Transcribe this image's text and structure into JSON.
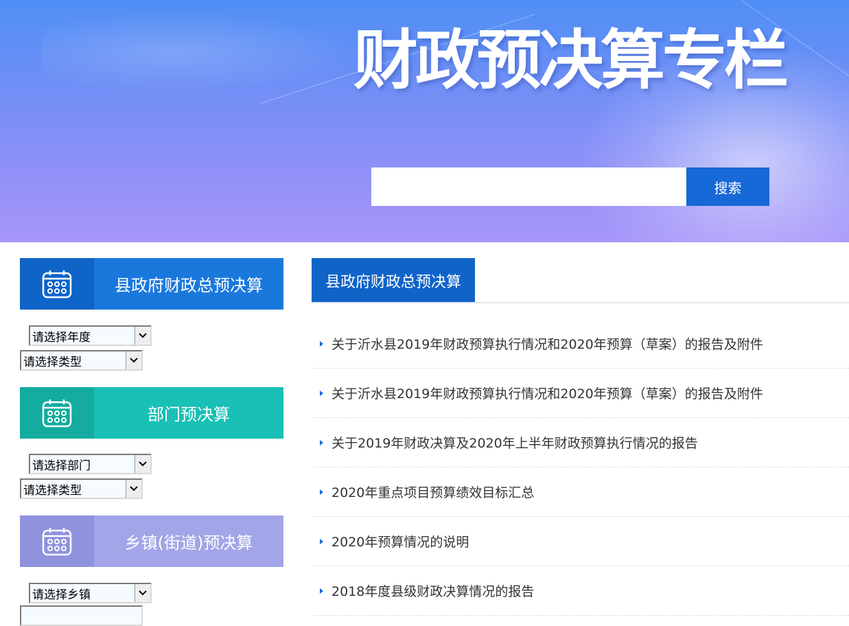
{
  "banner": {
    "title": "财政预决算专栏",
    "search_placeholder": "",
    "search_button": "搜索"
  },
  "sidebar": {
    "categories": [
      {
        "label": "县政府财政总预决算",
        "icon": "calendar-icon",
        "color_dark": "#0f64c8",
        "color_light": "#1a78dc",
        "selects": [
          "请选择年度",
          "请选择类型"
        ]
      },
      {
        "label": "部门预决算",
        "icon": "calendar-icon",
        "color_dark": "#14ac9f",
        "color_light": "#18c0b5",
        "selects": [
          "请选择部门",
          "请选择类型"
        ]
      },
      {
        "label": "乡镇(街道)预决算",
        "icon": "calendar-icon",
        "color_dark": "#8f92dc",
        "color_light": "#a2a5e7",
        "selects": [
          "请选择乡镇"
        ]
      }
    ]
  },
  "main": {
    "tab_label": "县政府财政总预决算",
    "items": [
      "关于沂水县2019年财政预算执行情况和2020年预算（草案）的报告及附件",
      "关于沂水县2019年财政预算执行情况和2020年预算（草案）的报告及附件",
      "关于2019年财政决算及2020年上半年财政预算执行情况的报告",
      "2020年重点项目预算绩效目标汇总",
      "2020年预算情况的说明",
      "2018年度县级财政决算情况的报告"
    ]
  },
  "colors": {
    "accent": "#1769d8",
    "banner_top": "#4f8ff5",
    "banner_bottom": "#a796f9"
  }
}
